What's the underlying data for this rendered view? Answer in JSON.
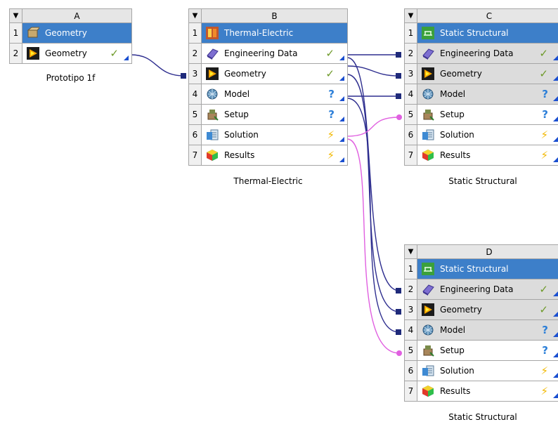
{
  "systems": {
    "A": {
      "letter": "A",
      "caption": "Prototipo 1f",
      "rows": [
        {
          "num": "1",
          "label": "Geometry",
          "icon": "geometry-box-icon",
          "status": ""
        },
        {
          "num": "2",
          "label": "Geometry",
          "icon": "geometry-icon",
          "status": "✓"
        }
      ]
    },
    "B": {
      "letter": "B",
      "caption": "Thermal-Electric",
      "rows": [
        {
          "num": "1",
          "label": "Thermal-Electric",
          "icon": "thermal-electric-icon",
          "status": ""
        },
        {
          "num": "2",
          "label": "Engineering Data",
          "icon": "engineering-data-icon",
          "status": "✓"
        },
        {
          "num": "3",
          "label": "Geometry",
          "icon": "geometry-icon",
          "status": "✓"
        },
        {
          "num": "4",
          "label": "Model",
          "icon": "model-icon",
          "status": "?"
        },
        {
          "num": "5",
          "label": "Setup",
          "icon": "setup-icon",
          "status": "?"
        },
        {
          "num": "6",
          "label": "Solution",
          "icon": "solution-icon",
          "status": "⚡"
        },
        {
          "num": "7",
          "label": "Results",
          "icon": "results-icon",
          "status": "⚡"
        }
      ]
    },
    "C": {
      "letter": "C",
      "caption": "Static Structural",
      "rows": [
        {
          "num": "1",
          "label": "Static Structural",
          "icon": "static-structural-icon",
          "status": ""
        },
        {
          "num": "2",
          "label": "Engineering Data",
          "icon": "engineering-data-icon",
          "status": "✓"
        },
        {
          "num": "3",
          "label": "Geometry",
          "icon": "geometry-icon",
          "status": "✓"
        },
        {
          "num": "4",
          "label": "Model",
          "icon": "model-icon",
          "status": "?"
        },
        {
          "num": "5",
          "label": "Setup",
          "icon": "setup-icon",
          "status": "?"
        },
        {
          "num": "6",
          "label": "Solution",
          "icon": "solution-icon",
          "status": "⚡"
        },
        {
          "num": "7",
          "label": "Results",
          "icon": "results-icon",
          "status": "⚡"
        }
      ]
    },
    "D": {
      "letter": "D",
      "caption": "Static Structural",
      "rows": [
        {
          "num": "1",
          "label": "Static Structural",
          "icon": "static-structural-icon",
          "status": ""
        },
        {
          "num": "2",
          "label": "Engineering Data",
          "icon": "engineering-data-icon",
          "status": "✓"
        },
        {
          "num": "3",
          "label": "Geometry",
          "icon": "geometry-icon",
          "status": "✓"
        },
        {
          "num": "4",
          "label": "Model",
          "icon": "model-icon",
          "status": "?"
        },
        {
          "num": "5",
          "label": "Setup",
          "icon": "setup-icon",
          "status": "?"
        },
        {
          "num": "6",
          "label": "Solution",
          "icon": "solution-icon",
          "status": "⚡"
        },
        {
          "num": "7",
          "label": "Results",
          "icon": "results-icon",
          "status": "⚡"
        }
      ]
    }
  },
  "colors": {
    "title_row": "#3d7fc9",
    "shared_row": "#dcdcdc",
    "data_link": "#2e2e8f",
    "solution_link": "#e060e0",
    "check": "#6e9a2a",
    "question": "#2c7fd8",
    "bolt": "#f2b800"
  }
}
